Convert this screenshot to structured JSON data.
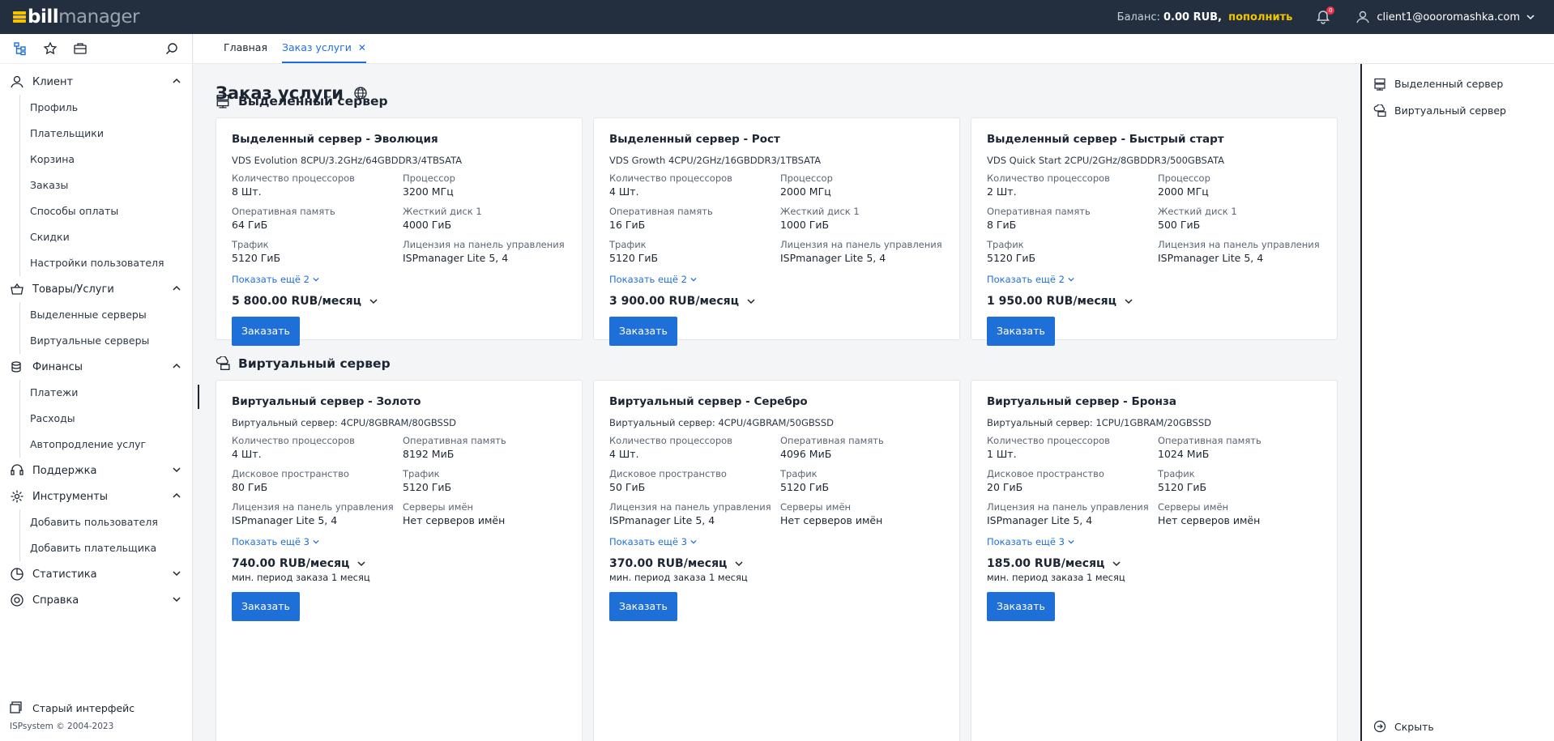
{
  "topbar": {
    "logo_bill": "bill",
    "logo_manager": "manager",
    "balance_label": "Баланс:",
    "balance_value": "0.00 RUB,",
    "topup": "пополнить",
    "notifications_count": "0",
    "user": "client1@oooromashka.com"
  },
  "sidebar": {
    "sections": [
      {
        "label": "Клиент",
        "icon": "user-icon",
        "expanded": true,
        "items": [
          "Профиль",
          "Плательщики",
          "Корзина",
          "Заказы",
          "Способы оплаты",
          "Скидки",
          "Настройки пользователя"
        ]
      },
      {
        "label": "Товары/Услуги",
        "icon": "basket-icon",
        "expanded": true,
        "items": [
          "Выделенные серверы",
          "Виртуальные серверы"
        ]
      },
      {
        "label": "Финансы",
        "icon": "coins-icon",
        "expanded": true,
        "items": [
          "Платежи",
          "Расходы",
          "Автопродление услуг"
        ]
      },
      {
        "label": "Поддержка",
        "icon": "support-icon",
        "expanded": false,
        "items": []
      },
      {
        "label": "Инструменты",
        "icon": "gear-icon",
        "expanded": true,
        "items": [
          "Добавить пользователя",
          "Добавить плательщика"
        ]
      },
      {
        "label": "Статистика",
        "icon": "pie-chart-icon",
        "expanded": false,
        "items": []
      },
      {
        "label": "Справка",
        "icon": "help-icon",
        "expanded": false,
        "items": []
      }
    ],
    "old_ui": "Старый интерфейс",
    "copyright": "ISPsystem © 2004-2023"
  },
  "tabs": [
    {
      "label": "Главная",
      "active": false
    },
    {
      "label": "Заказ услуги",
      "active": true,
      "close": "✕"
    }
  ],
  "main": {
    "page_title": "Заказ услуги",
    "groups": [
      {
        "title": "Выделенный сервер",
        "icon": "server-icon",
        "cards": [
          {
            "title": "Выделенный сервер - Эволюция",
            "desc": "VDS Evolution 8CPU/3.2GHz/64GBDDR3/4TBSATA",
            "props": [
              [
                "Количество процессоров",
                "8 Шт."
              ],
              [
                "Процессор",
                "3200 МГц"
              ],
              [
                "Оперативная память",
                "64 ГиБ"
              ],
              [
                "Жесткий диск 1",
                "4000 ГиБ"
              ],
              [
                "Трафик",
                "5120 ГиБ"
              ],
              [
                "Лицензия на панель управления",
                "ISPmanager Lite 5, 4"
              ]
            ],
            "more": "Показать ещё 2",
            "price": "5 800.00 RUB/месяц",
            "min_period": "",
            "button": "Заказать"
          },
          {
            "title": "Выделенный сервер - Рост",
            "desc": "VDS Growth 4CPU/2GHz/16GBDDR3/1TBSATA",
            "props": [
              [
                "Количество процессоров",
                "4 Шт."
              ],
              [
                "Процессор",
                "2000 МГц"
              ],
              [
                "Оперативная память",
                "16 ГиБ"
              ],
              [
                "Жесткий диск 1",
                "1000 ГиБ"
              ],
              [
                "Трафик",
                "5120 ГиБ"
              ],
              [
                "Лицензия на панель управления",
                "ISPmanager Lite 5, 4"
              ]
            ],
            "more": "Показать ещё 2",
            "price": "3 900.00 RUB/месяц",
            "min_period": "",
            "button": "Заказать"
          },
          {
            "title": "Выделенный сервер - Быстрый старт",
            "desc": "VDS Quick Start 2CPU/2GHz/8GBDDR3/500GBSATA",
            "props": [
              [
                "Количество процессоров",
                "2 Шт."
              ],
              [
                "Процессор",
                "2000 МГц"
              ],
              [
                "Оперативная память",
                "8 ГиБ"
              ],
              [
                "Жесткий диск 1",
                "500 ГиБ"
              ],
              [
                "Трафик",
                "5120 ГиБ"
              ],
              [
                "Лицензия на панель управления",
                "ISPmanager Lite 5, 4"
              ]
            ],
            "more": "Показать ещё 2",
            "price": "1 950.00 RUB/месяц",
            "min_period": "",
            "button": "Заказать"
          }
        ]
      },
      {
        "title": "Виртуальный сервер",
        "icon": "cloud-server-icon",
        "cards": [
          {
            "title": "Виртуальный сервер - Золото",
            "desc": "Виртуальный сервер: 4CPU/8GBRAM/80GBSSD",
            "props": [
              [
                "Количество процессоров",
                "4 Шт."
              ],
              [
                "Оперативная память",
                "8192 МиБ"
              ],
              [
                "Дисковое пространство",
                "80 ГиБ"
              ],
              [
                "Трафик",
                "5120 ГиБ"
              ],
              [
                "Лицензия на панель управления",
                "ISPmanager Lite 5, 4"
              ],
              [
                "Серверы имён",
                "Нет серверов имён"
              ]
            ],
            "more": "Показать ещё 3",
            "price": "740.00 RUB/месяц",
            "min_period": "мин. период заказа 1 месяц",
            "button": "Заказать"
          },
          {
            "title": "Виртуальный сервер - Серебро",
            "desc": "Виртуальный сервер: 4CPU/4GBRAM/50GBSSD",
            "props": [
              [
                "Количество процессоров",
                "4 Шт."
              ],
              [
                "Оперативная память",
                "4096 МиБ"
              ],
              [
                "Дисковое пространство",
                "50 ГиБ"
              ],
              [
                "Трафик",
                "5120 ГиБ"
              ],
              [
                "Лицензия на панель управления",
                "ISPmanager Lite 5, 4"
              ],
              [
                "Серверы имён",
                "Нет серверов имён"
              ]
            ],
            "more": "Показать ещё 3",
            "price": "370.00 RUB/месяц",
            "min_period": "мин. период заказа 1 месяц",
            "button": "Заказать"
          },
          {
            "title": "Виртуальный сервер - Бронза",
            "desc": "Виртуальный сервер: 1CPU/1GBRAM/20GBSSD",
            "props": [
              [
                "Количество процессоров",
                "1 Шт."
              ],
              [
                "Оперативная память",
                "1024 МиБ"
              ],
              [
                "Дисковое пространство",
                "20 ГиБ"
              ],
              [
                "Трафик",
                "5120 ГиБ"
              ],
              [
                "Лицензия на панель управления",
                "ISPmanager Lite 5, 4"
              ],
              [
                "Серверы имён",
                "Нет серверов имён"
              ]
            ],
            "more": "Показать ещё 3",
            "price": "185.00 RUB/месяц",
            "min_period": "мин. период заказа 1 месяц",
            "button": "Заказать"
          }
        ]
      }
    ]
  },
  "right_panel": {
    "items": [
      {
        "label": "Выделенный сервер",
        "icon": "server-icon"
      },
      {
        "label": "Виртуальный сервер",
        "icon": "cloud-server-icon"
      }
    ],
    "hide": "Скрыть"
  },
  "colors": {
    "accent": "#1f6fd9",
    "topbar": "#232f3e",
    "brand_yellow": "#f5c400"
  }
}
